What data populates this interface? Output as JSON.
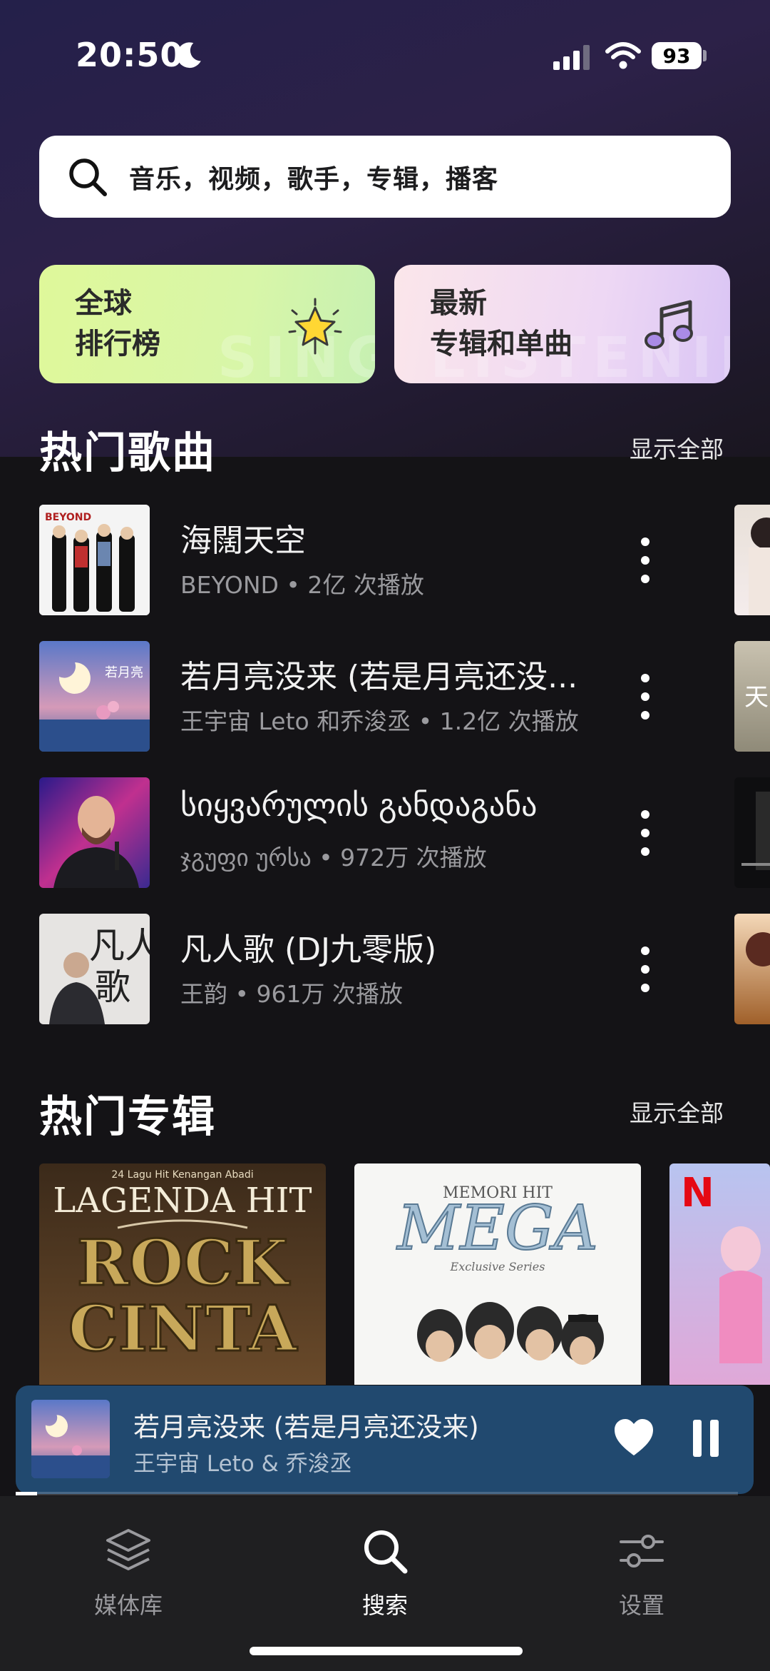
{
  "status_bar": {
    "time": "20:50",
    "battery": "93"
  },
  "search": {
    "placeholder": "音乐，视频，歌手，专辑，播客"
  },
  "cards": [
    {
      "line1": "全球",
      "line2": "排行榜"
    },
    {
      "line1": "最新",
      "line2": "专辑和单曲"
    }
  ],
  "popular_songs": {
    "title": "热门歌曲",
    "show_all": "显示全部",
    "items": [
      {
        "title": "海闊天空",
        "subtitle": "BEYOND • 2亿 次播放"
      },
      {
        "title": "若月亮没来 (若是月亮还没...",
        "subtitle": "王宇宙 Leto 和乔浚丞 • 1.2亿 次播放"
      },
      {
        "title": "სიყვარულის განდაგანა",
        "subtitle": "ჯგუფი ურსა • 972万 次播放"
      },
      {
        "title": "凡人歌 (DJ九零版)",
        "subtitle": "王韵 • 961万 次播放"
      }
    ]
  },
  "popular_albums": {
    "title": "热门专辑",
    "show_all": "显示全部"
  },
  "now_playing": {
    "title": "若月亮没来 (若是月亮还没来)",
    "artist": "王宇宙 Leto & 乔浚丞",
    "progress": 0.03
  },
  "tabs": [
    {
      "label": "媒体库",
      "icon": "layers-icon",
      "active": false
    },
    {
      "label": "搜索",
      "icon": "search-icon",
      "active": true
    },
    {
      "label": "设置",
      "icon": "sliders-icon",
      "active": false
    }
  ]
}
